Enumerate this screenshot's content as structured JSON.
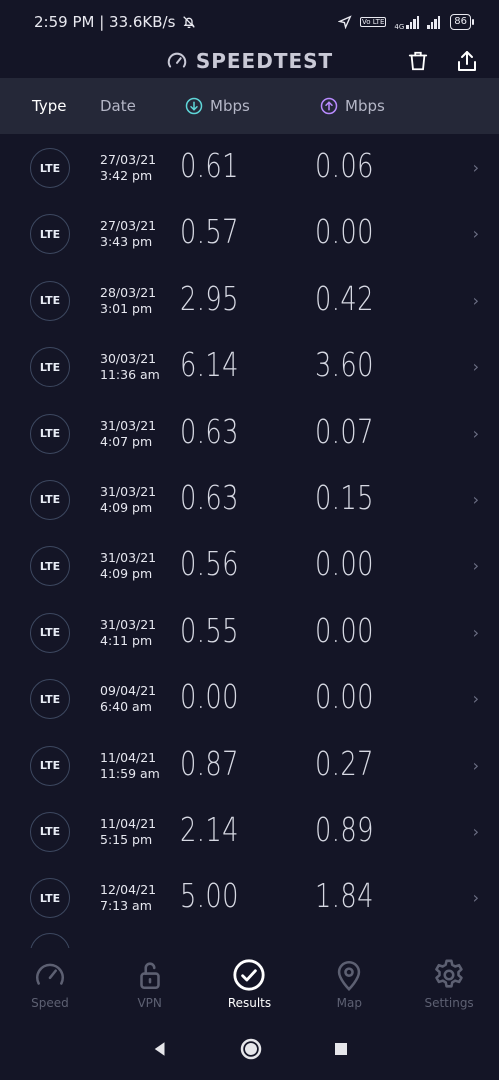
{
  "status_bar": {
    "time_speed": "2:59 PM | 33.6KB/s",
    "network_4g": "4G",
    "volte": "Vo LTE",
    "battery": "86"
  },
  "header": {
    "title": "SPEEDTEST"
  },
  "columns": {
    "type": "Type",
    "date": "Date",
    "download_unit": "Mbps",
    "upload_unit": "Mbps"
  },
  "results": [
    {
      "type": "LTE",
      "date": "27/03/21",
      "time": "3:42 pm",
      "download": "0.61",
      "upload": "0.06"
    },
    {
      "type": "LTE",
      "date": "27/03/21",
      "time": "3:43 pm",
      "download": "0.57",
      "upload": "0.00"
    },
    {
      "type": "LTE",
      "date": "28/03/21",
      "time": "3:01 pm",
      "download": "2.95",
      "upload": "0.42"
    },
    {
      "type": "LTE",
      "date": "30/03/21",
      "time": "11:36 am",
      "download": "6.14",
      "upload": "3.60"
    },
    {
      "type": "LTE",
      "date": "31/03/21",
      "time": "4:07 pm",
      "download": "0.63",
      "upload": "0.07"
    },
    {
      "type": "LTE",
      "date": "31/03/21",
      "time": "4:09 pm",
      "download": "0.63",
      "upload": "0.15"
    },
    {
      "type": "LTE",
      "date": "31/03/21",
      "time": "4:09 pm",
      "download": "0.56",
      "upload": "0.00"
    },
    {
      "type": "LTE",
      "date": "31/03/21",
      "time": "4:11 pm",
      "download": "0.55",
      "upload": "0.00"
    },
    {
      "type": "LTE",
      "date": "09/04/21",
      "time": "6:40 am",
      "download": "0.00",
      "upload": "0.00"
    },
    {
      "type": "LTE",
      "date": "11/04/21",
      "time": "11:59 am",
      "download": "0.87",
      "upload": "0.27"
    },
    {
      "type": "LTE",
      "date": "11/04/21",
      "time": "5:15 pm",
      "download": "2.14",
      "upload": "0.89"
    },
    {
      "type": "LTE",
      "date": "12/04/21",
      "time": "7:13 am",
      "download": "5.00",
      "upload": "1.84"
    }
  ],
  "nav": [
    {
      "label": "Speed"
    },
    {
      "label": "VPN"
    },
    {
      "label": "Results"
    },
    {
      "label": "Map"
    },
    {
      "label": "Settings"
    }
  ],
  "colors": {
    "background": "#141526",
    "header_bar": "#252838",
    "download_accent": "#5fd6d8",
    "upload_accent": "#b98bff"
  }
}
